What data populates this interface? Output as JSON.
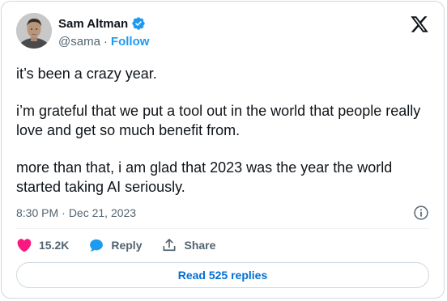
{
  "author": {
    "display_name": "Sam Altman",
    "handle": "@sama",
    "separator": "·",
    "follow_label": "Follow",
    "verified": true
  },
  "tweet": {
    "paragraphs": [
      "it’s been a crazy year.",
      "i’m grateful that we put a tool out in the world that people really love and get so much benefit from.",
      "more than that, i am glad that 2023 was the year the world started taking AI seriously."
    ],
    "time": "8:30 PM",
    "meta_separator": "·",
    "date": "Dec 21, 2023"
  },
  "actions": {
    "like_count": "15.2K",
    "reply_label": "Reply",
    "share_label": "Share"
  },
  "read_replies_label": "Read 525 replies",
  "colors": {
    "accent": "#1d9bf0",
    "link_button_text": "#006fd6",
    "like_heart": "#f91880",
    "secondary_text": "#536471",
    "border": "#cfd9de"
  },
  "icons": [
    "avatar-photo",
    "verified-badge-icon",
    "x-logo-icon",
    "info-icon",
    "heart-icon",
    "reply-bubble-icon",
    "share-icon"
  ]
}
